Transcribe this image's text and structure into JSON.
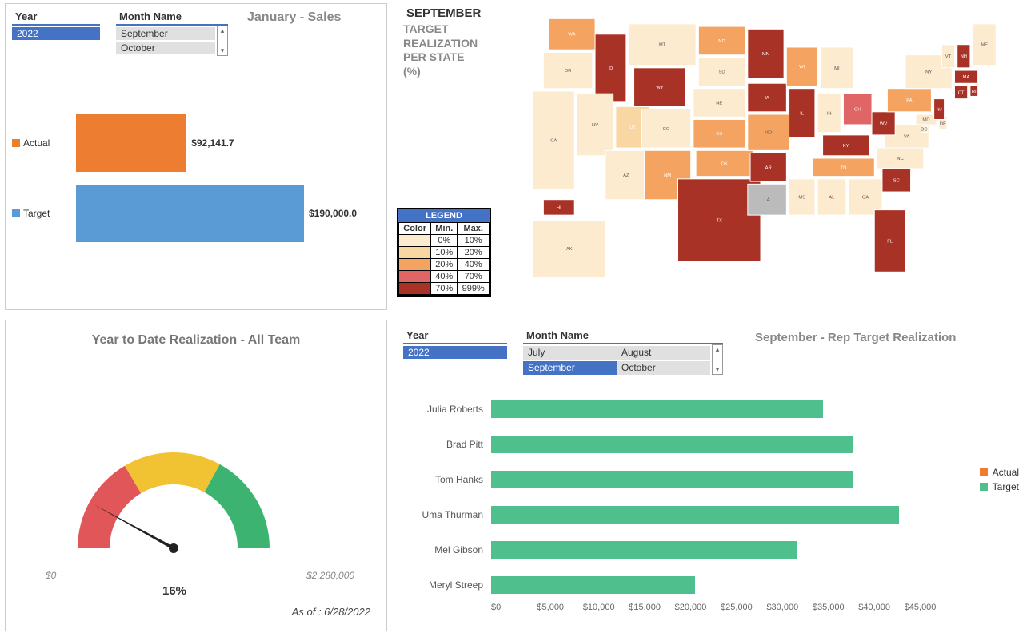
{
  "colors": {
    "orange": "#ED7D31",
    "blue": "#4472C4",
    "lightblue": "#5B9BD5",
    "teal": "#4FC08D",
    "red": "#E15759",
    "yellow": "#F1C232",
    "green": "#3CB371"
  },
  "panel1": {
    "year_label": "Year",
    "year_value": "2022",
    "month_label": "Month Name",
    "month_options": [
      "September",
      "October"
    ],
    "title": "January - Sales",
    "legend_actual": "Actual",
    "legend_target": "Target"
  },
  "panel2": {
    "title": "SEPTEMBER",
    "subtitle1": "TARGET",
    "subtitle2": "REALIZATION",
    "subtitle3": "PER STATE",
    "subtitle4": "(%)",
    "legend_header": "LEGEND",
    "legend_cols": [
      "Color",
      "Min.",
      "Max."
    ],
    "legend_rows": [
      {
        "color": "#FDEBD0",
        "min": "0%",
        "max": "10%"
      },
      {
        "color": "#F8D7A3",
        "min": "10%",
        "max": "20%"
      },
      {
        "color": "#F4A460",
        "min": "20%",
        "max": "40%"
      },
      {
        "color": "#E06666",
        "min": "40%",
        "max": "70%"
      },
      {
        "color": "#A93226",
        "min": "70%",
        "max": "999%"
      }
    ]
  },
  "panel3": {
    "title": "Year to Date Realization - All Team",
    "min_label": "$0",
    "max_label": "$2,280,000",
    "pct_label": "16%",
    "asof_label": "As of :  6/28/2022"
  },
  "panel4": {
    "year_label": "Year",
    "year_value": "2022",
    "month_label": "Month Name",
    "month_options": [
      "July",
      "August",
      "September",
      "October"
    ],
    "month_selected": "September",
    "title": "September - Rep Target Realization",
    "legend_actual": "Actual",
    "legend_target": "Target",
    "x_ticks": [
      "$0",
      "$5,000",
      "$10,000",
      "$15,000",
      "$20,000",
      "$25,000",
      "$30,000",
      "$35,000",
      "$40,000",
      "$45,000"
    ]
  },
  "chart_data": [
    {
      "id": "sales_bar",
      "type": "bar",
      "orientation": "horizontal",
      "title": "January - Sales",
      "categories": [
        "Actual",
        "Target"
      ],
      "values": [
        92141.7,
        190000.0
      ],
      "value_labels": [
        "$92,141.7",
        "$190,000.0"
      ],
      "colors": [
        "#ED7D31",
        "#5B9BD5"
      ],
      "xlim": [
        0,
        200000
      ]
    },
    {
      "id": "state_map",
      "type": "choropleth",
      "title": "September Target Realization per State (%)",
      "unit": "percent",
      "bins": [
        {
          "min": 0,
          "max": 10,
          "color": "#FDEBD0"
        },
        {
          "min": 10,
          "max": 20,
          "color": "#F8D7A3"
        },
        {
          "min": 20,
          "max": 40,
          "color": "#F4A460"
        },
        {
          "min": 40,
          "max": 70,
          "color": "#E06666"
        },
        {
          "min": 70,
          "max": 999,
          "color": "#A93226"
        }
      ],
      "data": {
        "WA": 30,
        "OR": 5,
        "CA": 5,
        "ID": 80,
        "NV": 5,
        "UT": 15,
        "AZ": 5,
        "MT": 5,
        "WY": 80,
        "CO": 5,
        "NM": 30,
        "ND": 30,
        "SD": 5,
        "NE": 5,
        "KS": 30,
        "OK": 30,
        "TX": 80,
        "MN": 80,
        "IA": 80,
        "MO": 30,
        "AR": 80,
        "LA": 0,
        "WI": 30,
        "IL": 80,
        "MI": 5,
        "IN": 5,
        "OH": 50,
        "KY": 80,
        "TN": 30,
        "MS": 5,
        "AL": 5,
        "GA": 5,
        "FL": 80,
        "SC": 80,
        "NC": 5,
        "VA": 5,
        "WV": 80,
        "MD": 5,
        "DE": 5,
        "PA": 30,
        "NJ": 80,
        "NY": 5,
        "CT": 80,
        "RI": 80,
        "MA": 80,
        "VT": 5,
        "NH": 80,
        "ME": 5,
        "AK": 5,
        "HI": 80,
        "DC": 5
      }
    },
    {
      "id": "ytd_gauge",
      "type": "gauge",
      "title": "Year to Date Realization - All Team",
      "min": 0,
      "max": 2280000,
      "value_pct": 16,
      "bands": [
        {
          "from": 0,
          "to": 33,
          "color": "#E15759"
        },
        {
          "from": 33,
          "to": 66,
          "color": "#F1C232"
        },
        {
          "from": 66,
          "to": 100,
          "color": "#3CB371"
        }
      ],
      "as_of": "6/28/2022"
    },
    {
      "id": "rep_target",
      "type": "bar",
      "orientation": "horizontal",
      "title": "September - Rep Target Realization",
      "xlabel": "",
      "xlim": [
        0,
        45000
      ],
      "categories": [
        "Julia Roberts",
        "Brad Pitt",
        "Tom Hanks",
        "Uma Thurman",
        "Mel Gibson",
        "Meryl Streep"
      ],
      "series": [
        {
          "name": "Target",
          "color": "#4FC08D",
          "values": [
            32500,
            35500,
            35500,
            40000,
            30000,
            20000
          ]
        },
        {
          "name": "Actual",
          "color": "#ED7D31",
          "values": [
            0,
            0,
            0,
            0,
            0,
            0
          ]
        }
      ]
    }
  ]
}
